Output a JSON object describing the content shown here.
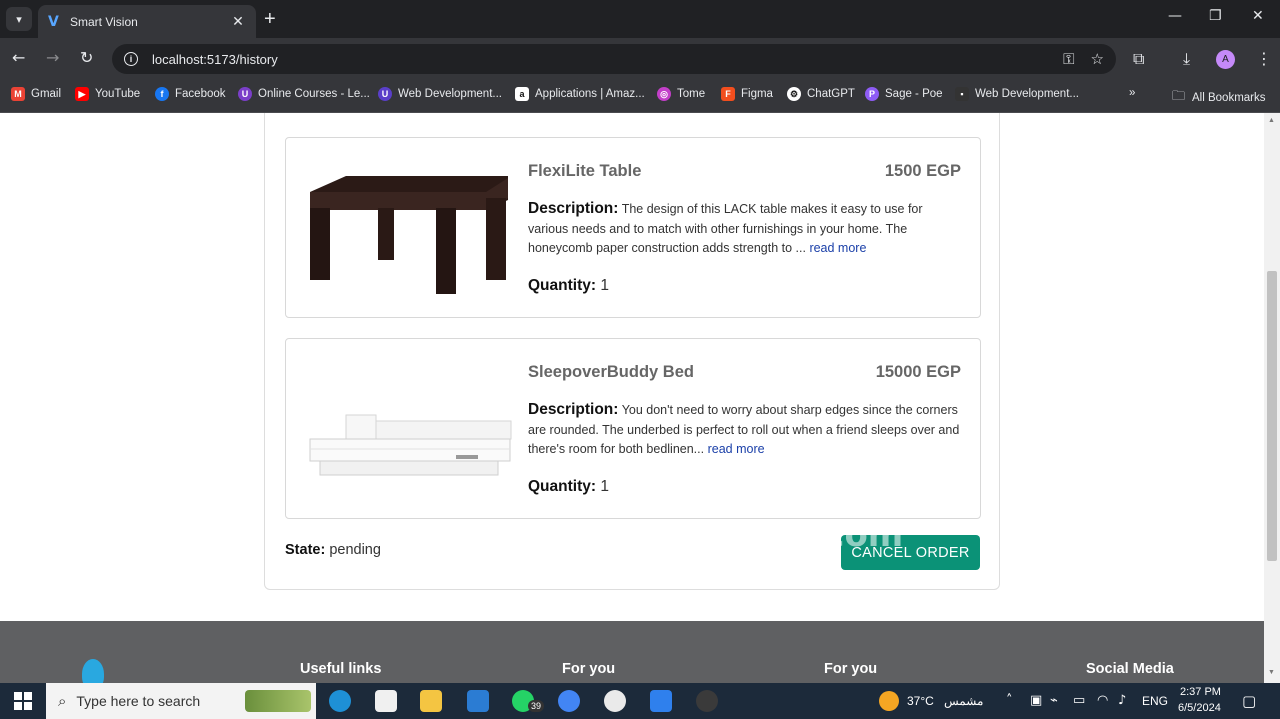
{
  "browser": {
    "tab_title": "Smart Vision",
    "url": "localhost:5173/history",
    "bookmarks": [
      {
        "label": "Gmail",
        "color": "#ea4335",
        "icon": "gmail-icon"
      },
      {
        "label": "YouTube",
        "color": "#ff0000",
        "icon": "youtube-icon"
      },
      {
        "label": "Facebook",
        "color": "#1877f2",
        "icon": "facebook-icon"
      },
      {
        "label": "Online Courses - Le...",
        "color": "#7b3fc9",
        "icon": "courses-icon"
      },
      {
        "label": "Web Development...",
        "color": "#5a3fc9",
        "icon": "webdev-icon"
      },
      {
        "label": "Applications | Amaz...",
        "color": "#ffffff",
        "icon": "amazon-icon"
      },
      {
        "label": "Tome",
        "color": "#c33fc9",
        "icon": "tome-icon"
      },
      {
        "label": "Figma",
        "color": "#f24e1e",
        "icon": "figma-icon"
      },
      {
        "label": "ChatGPT",
        "color": "#ffffff",
        "icon": "chatgpt-icon"
      },
      {
        "label": "Sage - Poe",
        "color": "#8e5cf5",
        "icon": "poe-icon"
      },
      {
        "label": "Web Development...",
        "color": "#333333",
        "icon": "webdev2-icon"
      }
    ],
    "all_bookmarks": "All Bookmarks"
  },
  "order": {
    "items": [
      {
        "name": "FlexiLite Table",
        "price": "1500 EGP",
        "desc_label": "Description:",
        "description": "The design of this LACK table makes it easy to use for various needs and to match with other furnishings in your home. The honeycomb paper construction adds strength to ...",
        "read_more": "read more",
        "qty_label": "Quantity:",
        "quantity": "1"
      },
      {
        "name": "SleepoverBuddy Bed",
        "price": "15000 EGP",
        "desc_label": "Description:",
        "description": "You don't need to worry about sharp edges since the corners are rounded. The underbed is perfect to roll out when a friend sleeps over and there's room for both bedlinen...",
        "read_more": "read more",
        "qty_label": "Quantity:",
        "quantity": "1"
      }
    ],
    "state_label": "State:",
    "state": "pending",
    "cancel_label": "CANCEL ORDER",
    "accent_color": "#0b9277"
  },
  "footer": {
    "headings": [
      "Useful links",
      "For you",
      "For you",
      "Social Media"
    ]
  },
  "watermark": "نفذلي nafezly.com",
  "taskbar": {
    "search_placeholder": "Type here to search",
    "whatsapp_badge": "39",
    "temperature": "37°C",
    "weather": "مشمس",
    "lang": "ENG",
    "time": "2:37 PM",
    "date": "6/5/2024"
  }
}
